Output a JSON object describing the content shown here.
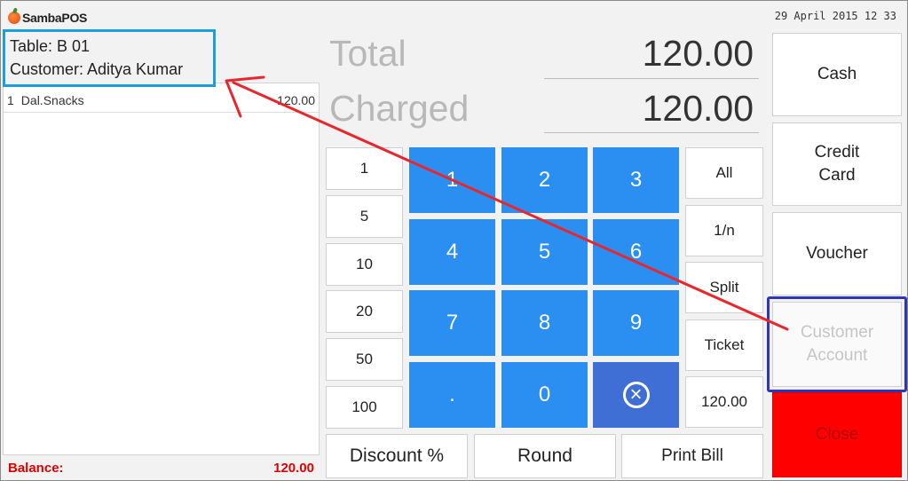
{
  "header": {
    "app_name": "SambaPOS",
    "datetime": "29 April 2015 12 33"
  },
  "ticket": {
    "table": "Table: B 01",
    "customer": "Customer: Aditya Kumar",
    "items": [
      {
        "qty": "1",
        "name": "Dal.Snacks",
        "price": "120.00"
      }
    ],
    "balance_label": "Balance:",
    "balance_value": "120.00"
  },
  "summary": {
    "total_label": "Total",
    "total_value": "120.00",
    "charged_label": "Charged",
    "charged_value": "120.00"
  },
  "amount_buttons": [
    "1",
    "5",
    "10",
    "20",
    "50",
    "100"
  ],
  "numpad": [
    "1",
    "2",
    "3",
    "4",
    "5",
    "6",
    "7",
    "8",
    "9",
    ".",
    "0"
  ],
  "split_buttons": [
    "All",
    "1/n",
    "Split",
    "Ticket",
    "120.00"
  ],
  "payment_buttons": {
    "cash": "Cash",
    "credit_line1": "Credit",
    "credit_line2": "Card",
    "voucher": "Voucher",
    "customer_line1": "Customer",
    "customer_line2": "Account",
    "close": "Close"
  },
  "bottom_buttons": {
    "discount": "Discount %",
    "round": "Round",
    "print_bill": "Print Bill"
  },
  "colors": {
    "numpad_blue": "#2b8ef1",
    "clear_key": "#3f6fd5",
    "close_red": "#ff0000",
    "info_highlight": "#1b9ede",
    "customer_highlight": "#2e35b8",
    "arrow_red": "#e8262c",
    "balance_red": "#e00000"
  }
}
